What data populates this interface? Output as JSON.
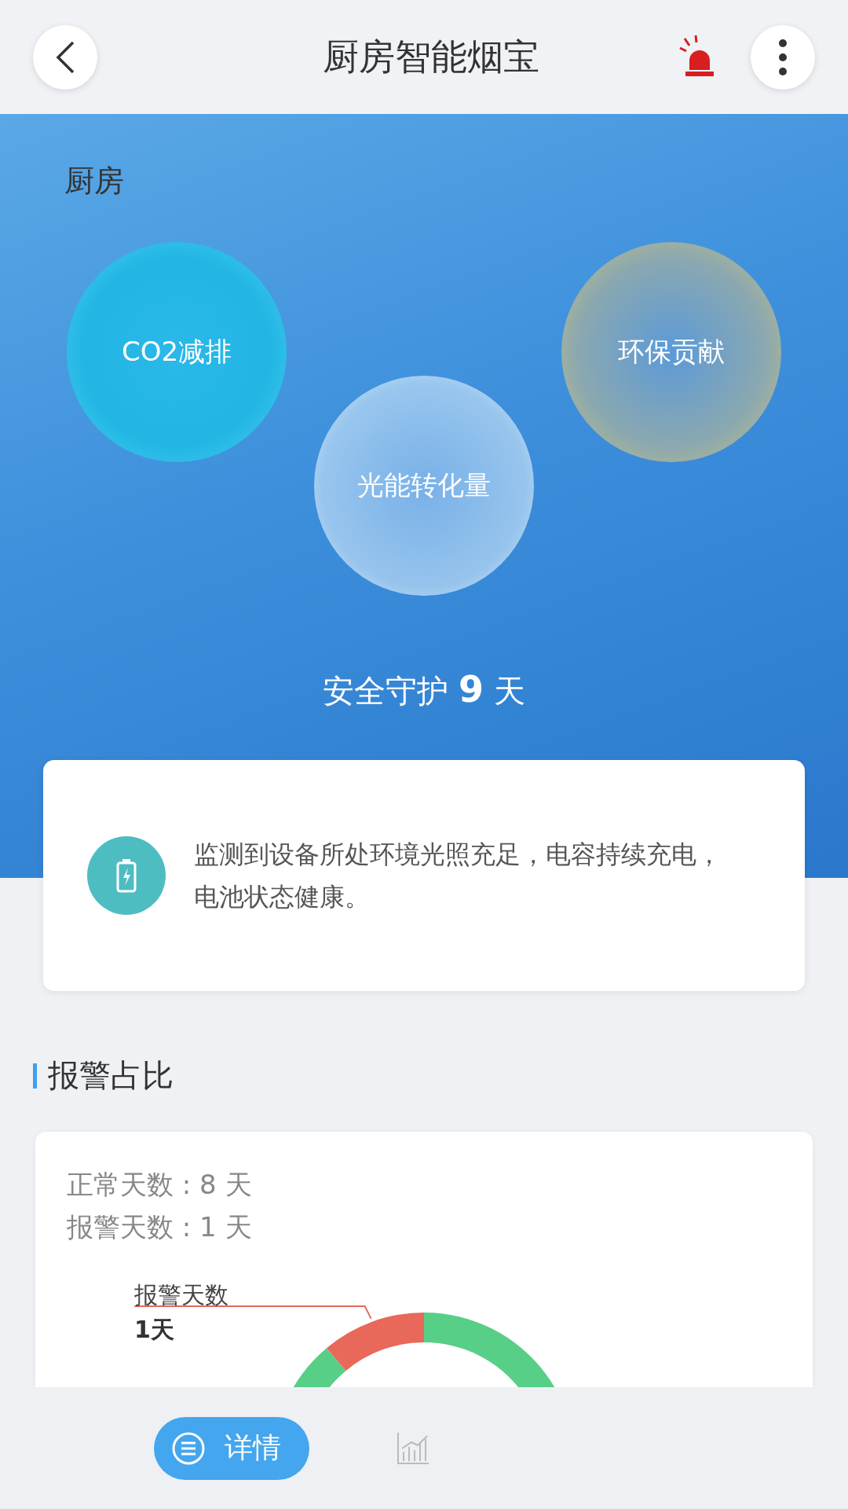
{
  "header": {
    "title": "厨房智能烟宝"
  },
  "hero": {
    "room": "厨房",
    "bubbles": [
      {
        "label": "CO2减排",
        "kind": "cyan"
      },
      {
        "label": "光能转化量",
        "kind": "white"
      },
      {
        "label": "环保贡献",
        "kind": "gold"
      }
    ],
    "guard": {
      "prefix": "安全守护",
      "days": "9",
      "suffix": "天"
    }
  },
  "status_card": {
    "message": "监测到设备所处环境光照充足，电容持续充电，电池状态健康。"
  },
  "alarm_section": {
    "title": "报警占比",
    "stats": [
      "正常天数 : 8 天",
      "报警天数 : 1 天"
    ],
    "chart_data": {
      "type": "donut",
      "values": [
        88.89,
        11.11
      ],
      "colors": [
        "#58cf86",
        "#e8685a"
      ]
    },
    "callout": {
      "label": "报警天数",
      "value": "1天"
    }
  },
  "bottom_bar": {
    "tabs": [
      {
        "label": "详情",
        "kind": "list",
        "selected": true
      },
      {
        "kind": "chart",
        "selected": false
      }
    ]
  }
}
